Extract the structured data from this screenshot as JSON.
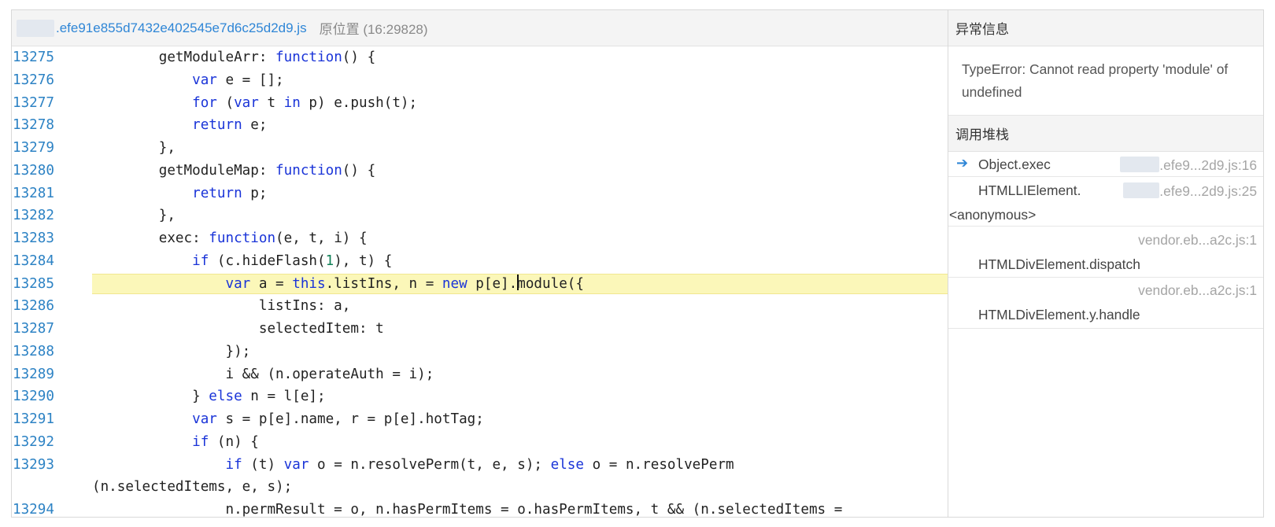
{
  "source": {
    "file_name": ".efe91e855d7432e402545e7d6c25d2d9.js",
    "original_position": "原位置 (16:29828)",
    "highlighted_line": "13285",
    "lines": [
      {
        "no": "13275",
        "tokens": [
          {
            "t": "        getModuleArr: "
          },
          {
            "t": "function",
            "c": "kw"
          },
          {
            "t": "() {"
          }
        ]
      },
      {
        "no": "13276",
        "tokens": [
          {
            "t": "            "
          },
          {
            "t": "var",
            "c": "kw"
          },
          {
            "t": " e = [];"
          }
        ]
      },
      {
        "no": "13277",
        "tokens": [
          {
            "t": "            "
          },
          {
            "t": "for",
            "c": "kw"
          },
          {
            "t": " ("
          },
          {
            "t": "var",
            "c": "kw"
          },
          {
            "t": " t "
          },
          {
            "t": "in",
            "c": "kw"
          },
          {
            "t": " p) e.push(t);"
          }
        ]
      },
      {
        "no": "13278",
        "tokens": [
          {
            "t": "            "
          },
          {
            "t": "return",
            "c": "kw"
          },
          {
            "t": " e;"
          }
        ]
      },
      {
        "no": "13279",
        "tokens": [
          {
            "t": "        },"
          }
        ]
      },
      {
        "no": "13280",
        "tokens": [
          {
            "t": "        getModuleMap: "
          },
          {
            "t": "function",
            "c": "kw"
          },
          {
            "t": "() {"
          }
        ]
      },
      {
        "no": "13281",
        "tokens": [
          {
            "t": "            "
          },
          {
            "t": "return",
            "c": "kw"
          },
          {
            "t": " p;"
          }
        ]
      },
      {
        "no": "13282",
        "tokens": [
          {
            "t": "        },"
          }
        ]
      },
      {
        "no": "13283",
        "tokens": [
          {
            "t": "        exec: "
          },
          {
            "t": "function",
            "c": "kw"
          },
          {
            "t": "(e, t, i) {"
          }
        ]
      },
      {
        "no": "13284",
        "tokens": [
          {
            "t": "            "
          },
          {
            "t": "if",
            "c": "kw"
          },
          {
            "t": " (c.hideFlash("
          },
          {
            "t": "1",
            "c": "num"
          },
          {
            "t": "), t) {"
          }
        ]
      },
      {
        "no": "13285",
        "hl": true,
        "tokens": [
          {
            "t": "                "
          },
          {
            "t": "var",
            "c": "kw"
          },
          {
            "t": " a = "
          },
          {
            "t": "this",
            "c": "kw"
          },
          {
            "t": ".listIns, n = "
          },
          {
            "t": "new",
            "c": "kw"
          },
          {
            "t": " p[e]."
          },
          {
            "t": "",
            "c": "cursor"
          },
          {
            "t": "module({"
          }
        ]
      },
      {
        "no": "13286",
        "tokens": [
          {
            "t": "                    listIns: a,"
          }
        ]
      },
      {
        "no": "13287",
        "tokens": [
          {
            "t": "                    selectedItem: t"
          }
        ]
      },
      {
        "no": "13288",
        "tokens": [
          {
            "t": "                });"
          }
        ]
      },
      {
        "no": "13289",
        "tokens": [
          {
            "t": "                i && (n.operateAuth = i);"
          }
        ]
      },
      {
        "no": "13290",
        "tokens": [
          {
            "t": "            } "
          },
          {
            "t": "else",
            "c": "kw"
          },
          {
            "t": " n = l[e];"
          }
        ]
      },
      {
        "no": "13291",
        "tokens": [
          {
            "t": "            "
          },
          {
            "t": "var",
            "c": "kw"
          },
          {
            "t": " s = p[e].name, r = p[e].hotTag;"
          }
        ]
      },
      {
        "no": "13292",
        "tokens": [
          {
            "t": "            "
          },
          {
            "t": "if",
            "c": "kw"
          },
          {
            "t": " (n) {"
          }
        ]
      },
      {
        "no": "13293",
        "tokens": [
          {
            "t": "                "
          },
          {
            "t": "if",
            "c": "kw"
          },
          {
            "t": " (t) "
          },
          {
            "t": "var",
            "c": "kw"
          },
          {
            "t": " o = n.resolvePerm(t, e, s); "
          },
          {
            "t": "else",
            "c": "kw"
          },
          {
            "t": " o = n.resolvePerm"
          }
        ]
      },
      {
        "no": "",
        "tokens": [
          {
            "t": "(n.selectedItems, e, s);"
          }
        ]
      },
      {
        "no": "13294",
        "tokens": [
          {
            "t": "                n.permResult = o, n.hasPermItems = o.hasPermItems, t && (n.selectedItems ="
          }
        ]
      }
    ]
  },
  "panel": {
    "exception_title": "异常信息",
    "error_message": "TypeError: Cannot read property 'module' of undefined",
    "stack_title": "调用堆栈",
    "frames": [
      {
        "fn": "Object.exec",
        "loc": ".efe9...2d9.js:16",
        "current": true
      },
      {
        "fn": "HTMLLIElement.",
        "fn2": "<anonymous>",
        "loc": ".efe9...2d9.js:25"
      },
      {
        "fn": "HTMLDivElement.dispatch",
        "loc": "vendor.eb...a2c.js:1"
      },
      {
        "fn": "HTMLDivElement.y.handle",
        "loc": "vendor.eb...a2c.js:1"
      }
    ],
    "current_frame_icon": "arrow-right-icon"
  },
  "colors": {
    "line_number": "#2c82c4",
    "keyword": "#1a34d8",
    "number": "#118057",
    "highlight": "#fbf7b9",
    "file_link": "#2f86d6"
  }
}
